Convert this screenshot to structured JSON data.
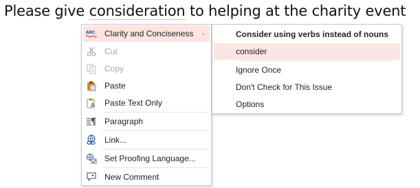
{
  "document": {
    "before": "Please give ",
    "flagged_word": "consideration",
    "after": " to helping at the charity event"
  },
  "context_menu": {
    "items": [
      {
        "label": "Clarity and Conciseness",
        "icon": "abc-spelling-icon",
        "has_submenu": true,
        "state": "highlighted"
      },
      {
        "label": "Cut",
        "icon": "scissors-icon",
        "state": "disabled"
      },
      {
        "label": "Copy",
        "icon": "copy-icon",
        "state": "disabled"
      },
      {
        "label": "Paste",
        "icon": "clipboard-icon",
        "state": "enabled"
      },
      {
        "label": "Paste Text Only",
        "icon": "paste-text-only-icon",
        "state": "enabled"
      },
      {
        "label": "Paragraph",
        "icon": "paragraph-icon",
        "state": "enabled"
      },
      {
        "label": "Link...",
        "icon": "link-icon",
        "state": "enabled"
      },
      {
        "label": "Set Proofing Language...",
        "icon": "proofing-language-icon",
        "state": "enabled"
      },
      {
        "label": "New Comment",
        "icon": "comment-icon",
        "state": "enabled"
      }
    ],
    "submenu_arrow": "›"
  },
  "submenu": {
    "heading": "Consider using verbs instead of nouns",
    "suggestion": "consider",
    "items": [
      {
        "label": "Ignore Once"
      },
      {
        "label": "Don't Check for This Issue"
      },
      {
        "label": "Options"
      }
    ]
  },
  "colors": {
    "highlight": "#fbe4e1",
    "disabled_text": "#a6a6a6",
    "flag_underline": "#c28a00",
    "icon_blue": "#2b5797",
    "icon_orange": "#d98a1b"
  }
}
